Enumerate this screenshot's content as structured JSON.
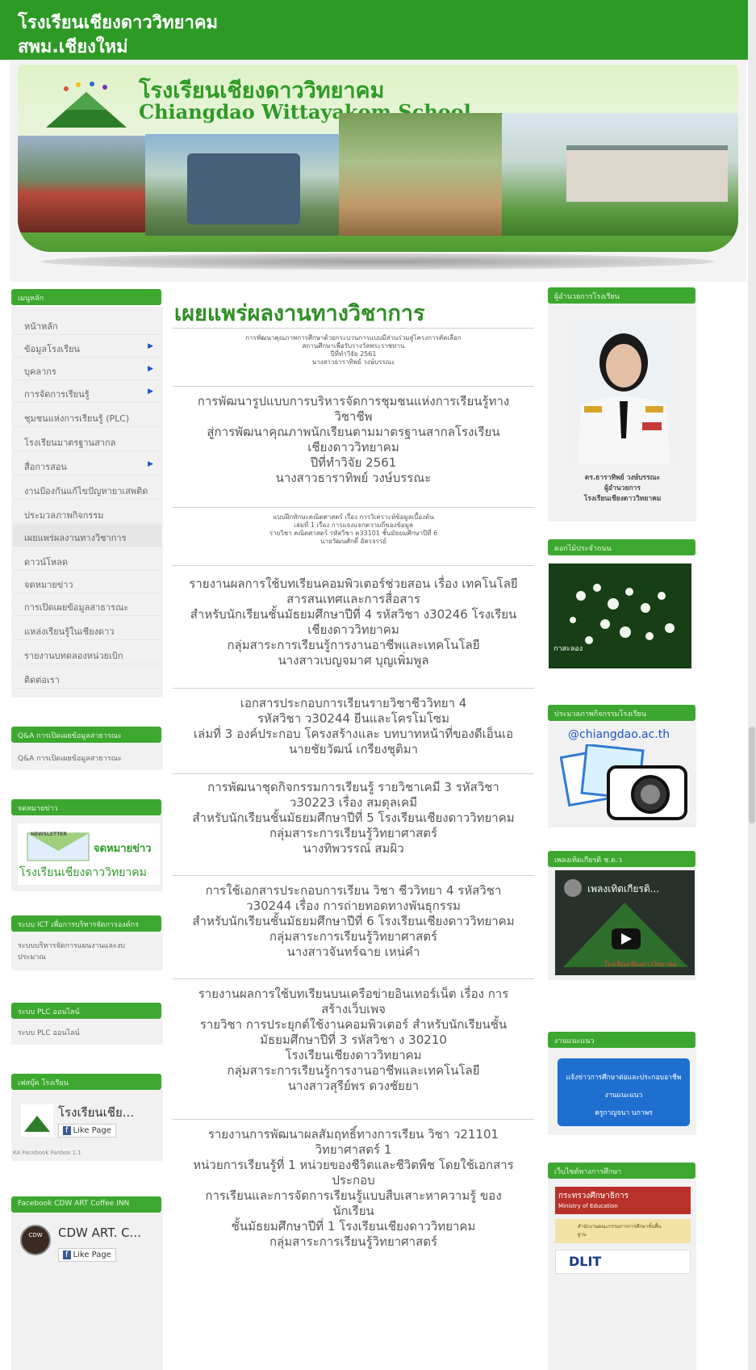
{
  "header": {
    "title_line1": "โรงเรียนเชียงดาววิทยาคม",
    "title_line2": "สพม.เชียงใหม่"
  },
  "banner": {
    "title_th": "โรงเรียนเชียงดาววิทยาคม",
    "title_en": "Chiangdao Wittayakom School"
  },
  "sidebar": {
    "menu_heading": "เมนูหลัก",
    "items": [
      {
        "label": "หน้าหลัก"
      },
      {
        "label": "ข้อมูลโรงเรียน"
      },
      {
        "label": "บุคลากร"
      },
      {
        "label": "การจัดการเรียนรู้"
      },
      {
        "label": "ชุมชนแห่งการเรียนรู้ (PLC)"
      },
      {
        "label": "โรงเรียนมาตรฐานสากล"
      },
      {
        "label": "สื่อการสอน"
      },
      {
        "label": "งานป้องกันแก้ไขปัญหายาเสพติด"
      },
      {
        "label": "ประมวลภาพกิจกรรม"
      },
      {
        "label": "เผยแพร่ผลงานทางวิชาการ"
      },
      {
        "label": "ดาวน์โหลด"
      },
      {
        "label": "จดหมายข่าว"
      },
      {
        "label": "การเปิดเผยข้อมูลสาธารณะ"
      },
      {
        "label": "แหล่งเรียนรู้ในเชียงดาว"
      },
      {
        "label": "รายงานบทดลองหน่วยเบิก"
      },
      {
        "label": "ติดต่อเรา"
      }
    ],
    "qa_heading": "Q&A การเปิดเผยข้อมูลสาธารณะ",
    "qa_link": "Q&A การเปิดเผยข้อมูลสาธารณะ",
    "newsletter_heading": "จดหมายข่าว",
    "newsletter_badge": "NEWSLETTER",
    "newsletter_title": "จดหมายข่าว",
    "newsletter_school": "โรงเรียนเชียงดาววิทยาคม",
    "ict_heading": "ระบบ ICT เพื่อการบริหารจัดการองค์กร",
    "ict_link": "ระบบบริหารจัดการแผนงานและงบประมาณ",
    "plc_heading": "ระบบ PLC ออนไลน์",
    "plc_link": "ระบบ PLC ออนไลน์",
    "fb_heading": "เฟสบุ๊ค โรงเรียน",
    "fb_page_name": "โรงเรียนเชีย...",
    "fb_like": "Like Page",
    "fb_fanbox": "KA Facebook Fanbox 1.1",
    "cdw_heading": "Facebook CDW ART Coffee INN",
    "cdw_name": "CDW ART. C...",
    "cdw_like": "Like Page"
  },
  "main": {
    "title": "เผยแพร่ผลงานทางวิชาการ",
    "small1": [
      "การพัฒนาคุณภาพการศึกษาด้วยกระบวนการแบบมีส่วนร่วมสู่โครงการคัดเลือก",
      "สถานศึกษาเพื่อรับรางวัลพระราชทาน",
      "ปีที่ทำวิจัย 2561",
      "นางสาวธาราทิพย์ วงษ์บรรณะ"
    ],
    "block1": [
      "การพัฒนารูปแบบการบริหารจัดการชุมชนแห่งการเรียนรู้ทาง",
      "วิชาชีพ",
      "สู่การพัฒนาคุณภาพนักเรียนตามมาตรฐานสากลโรงเรียน",
      "เชียงดาววิทยาคม",
      "ปีที่ทำวิจัย 2561",
      "นางสาวธาราทิพย์ วงษ์บรรณะ"
    ],
    "small2": [
      "แบบฝึกทักษะคณิตศาสตร์ เรื่อง การวิเคราะห์ข้อมูลเบื้องต้น",
      "เล่มที่ 1 เรื่อง การแจงแจกความถี่ของข้อมูล",
      "รายวิชา คณิตศาสตร์ รหัสวิชา ค33101 ชั้นมัธยมศึกษาปีที่ 6",
      "นายวัฒนศักดิ์ อัครจรรย์"
    ],
    "block2": [
      "รายงานผลการใช้บทเรียนคอมพิวเตอร์ช่วยสอน เรื่อง เทคโนโลยี",
      "สารสนเทศและการสื่อสาร",
      "สำหรับนักเรียนชั้นมัธยมศึกษาปีที่ 4 รหัสวิชา ง30246 โรงเรียน",
      "เชียงดาววิทยาคม",
      "กลุ่มสาระการเรียนรู้การงานอาชีพและเทคโนโลยี",
      "นางสาวเบญจมาศ บุญเพิ่มพูล"
    ],
    "block3": [
      "เอกสารประกอบการเรียนรายวิชาชีววิทยา 4",
      "รหัสวิชา ว30244 ยีนและโครโมโซม",
      "เล่มที่ 3 องค์ประกอบ โครงสร้างและ บทบาทหน้าที่ของดีเอ็นเอ",
      "นายชัยวัฒน์ เกรียงชุติมา"
    ],
    "block4": [
      "การพัฒนาชุดกิจกรรมการเรียนรู้ รายวิชาเคมี 3 รหัสวิชา",
      "ว30223 เรื่อง สมดุลเคมี",
      "สำหรับนักเรียนชั้นมัธยมศึกษาปีที่ 5 โรงเรียนเชียงดาววิทยาคม",
      "กลุ่มสาระการเรียนรู้วิทยาศาสตร์",
      "นางทิพวรรณ์ สมผิว"
    ],
    "block5": [
      "การใช้เอกสารประกอบการเรียน วิชา ชีววิทยา 4 รหัสวิชา",
      "ว30244 เรื่อง การถ่ายทอดทางพันธุกรรม",
      "สำหรับนักเรียนชั้นมัธยมศึกษาปีที่ 6 โรงเรียนเชียงดาววิทยาคม",
      "กลุ่มสาระการเรียนรู้วิทยาศาสตร์",
      "นางสาวจันทร์ฉาย เหน่คำ"
    ],
    "block6": [
      "รายงานผลการใช้บทเรียนบนเครือข่ายอินเทอร์เน็ต เรื่อง การ",
      "สร้างเว็บเพจ",
      "รายวิชา การประยุกต์ใช้งานคอมพิวเตอร์ สำหรับนักเรียนชั้น",
      "มัธยมศึกษาปีที่ 3 รหัสวิชา ง 30210",
      "โรงเรียนเชียงดาววิทยาคม",
      "กลุ่มสาระการเรียนรู้การงานอาชีพและเทคโนโลยี",
      "นางสาวสุรีย์พร ดวงชัยยา"
    ],
    "block7": [
      "รายงานการพัฒนาผลสัมฤทธิ์ทางการเรียน วิชา ว21101",
      "วิทยาศาสตร์ 1",
      "หน่วยการเรียนรู้ที่ 1 หน่วยของชีวิตและชีวิตพืช โดยใช้เอกสาร",
      "ประกอบ",
      "การเรียนและการจัดการเรียนรู้แบบสืบเสาะหาความรู้ ของ",
      "นักเรียน",
      "ชั้นมัธยมศึกษาปีที่ 1 โรงเรียนเชียงดาววิทยาคม",
      "กลุ่มสาระการเรียนรู้วิทยาศาสตร์"
    ]
  },
  "right": {
    "director_heading": "ผู้อำนวยการโรงเรียน",
    "director_name": "ดร.ธาราทิพย์ วงษ์บรรณะ",
    "director_role": "ผู้อำนวยการ",
    "director_school": "โรงเรียนเชียงดาววิทยาคม",
    "flower_heading": "ดอกไม้ประจำถนน",
    "flower_caption": "กาสะลอง",
    "gallery_heading": "ประมวลภาพกิจกรรมโรงเรียน",
    "gallery_site": "@chiangdao.ac.th",
    "video_heading": "เพลงเทิดเกียรติ ช.ด.ว",
    "video_title": "เพลงเทิดเกียรติ...",
    "video_logo_text": "โรงเรียนเชียงดาววิทยาคม",
    "jobs_heading": "งานแนะแนว",
    "jobs_lines": [
      "แจ้งข่าวการศึกษาต่อและประกอบอาชีพ",
      "งานแนะแนว",
      "ครูกาญจนา นกาพร"
    ],
    "links_heading": "เว็บไซต์ทางการศึกษา",
    "moe_th": "กระทรวงศึกษาธิการ",
    "moe_en": "Ministry of Education",
    "obec_text": "สำนักงานคณะกรรมการการศึกษาขั้นพื้นฐาน",
    "dlit_text": "DLIT"
  },
  "colors": {
    "green": "#2e9a26",
    "panel_green": "#3da830",
    "link_blue": "#1b55c8"
  }
}
